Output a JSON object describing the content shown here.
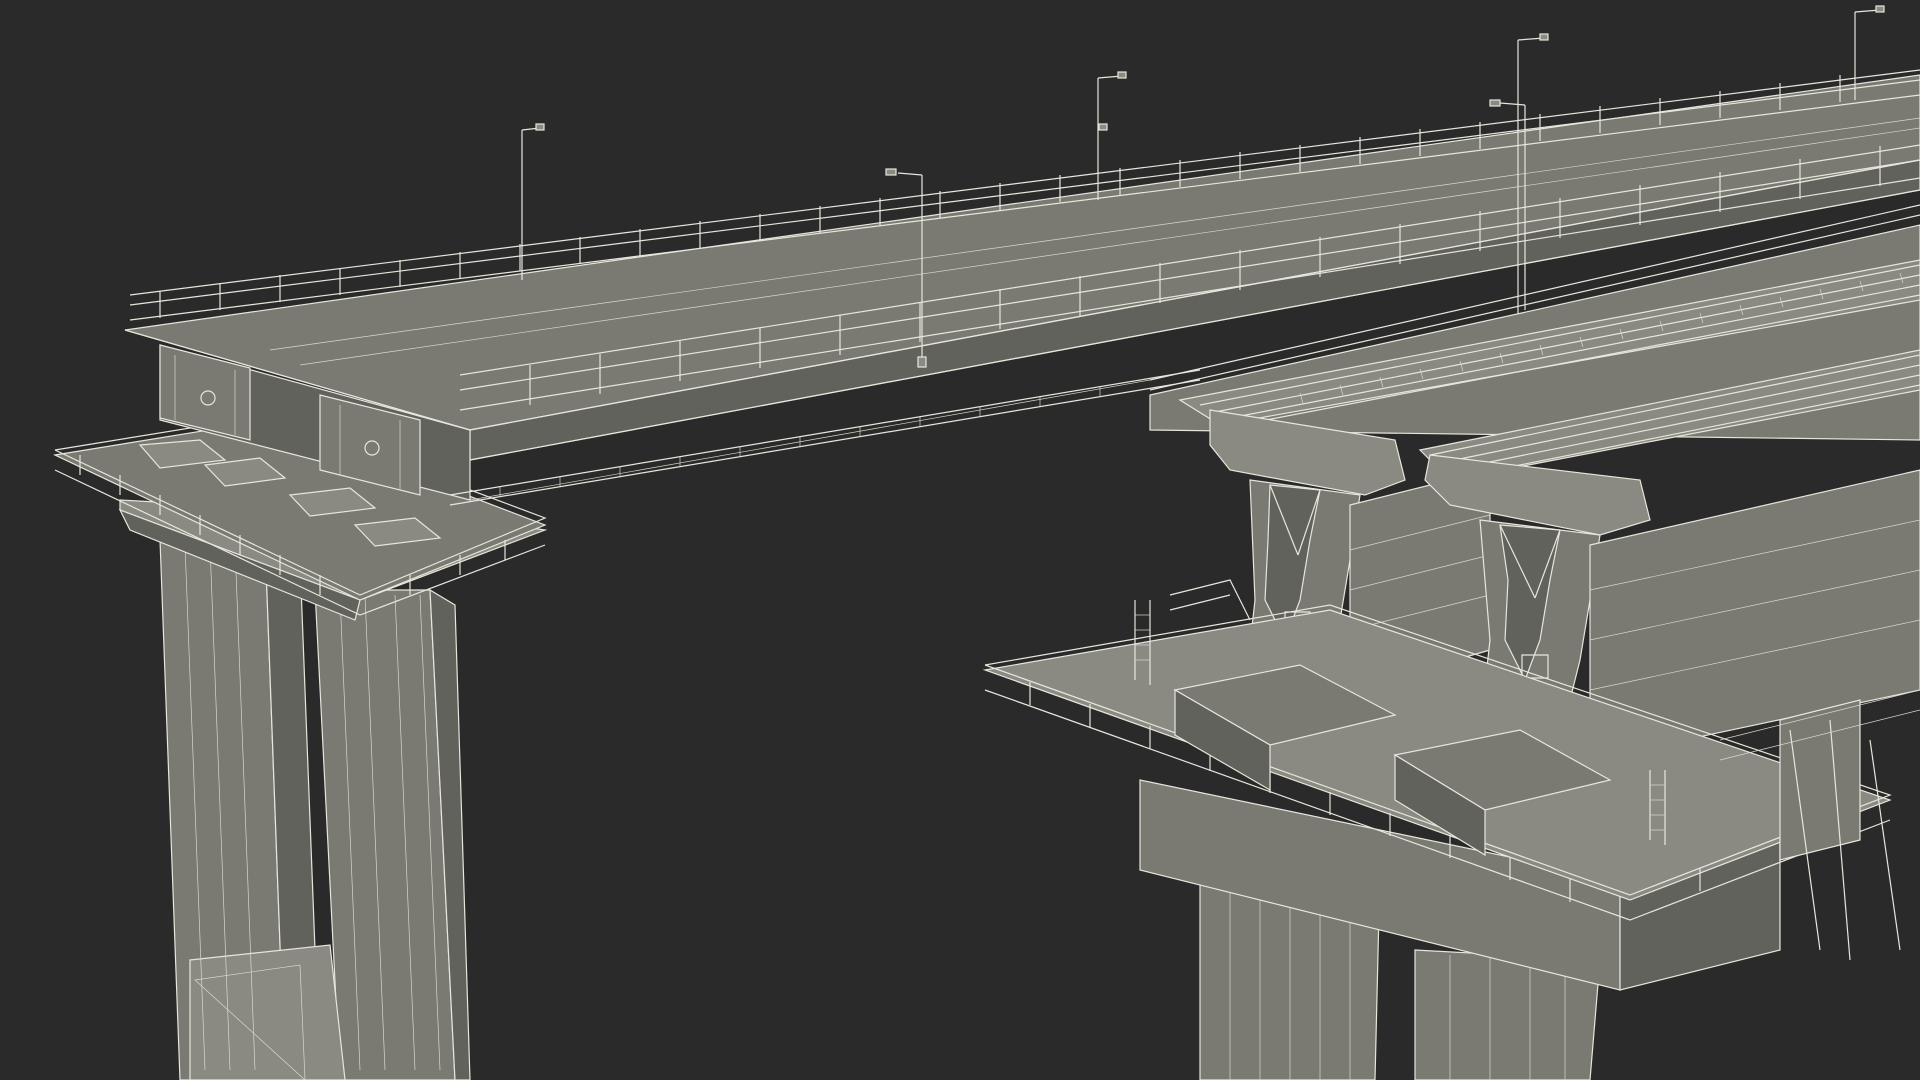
{
  "scene": {
    "subject": "bridge-wireframe-render",
    "background_color": "#2a2a2a",
    "wire_color": "#e6e6dc",
    "surface_color": "#7a7a72"
  },
  "elements": {
    "left_pier": "pier",
    "right_piers": "pier",
    "road_deck": "deck",
    "rail_deck": "deck",
    "lamps": "street-lamp"
  }
}
